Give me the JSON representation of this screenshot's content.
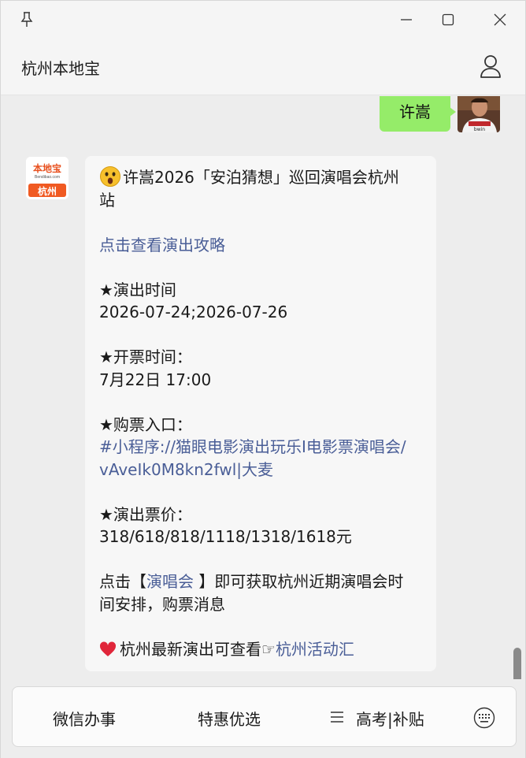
{
  "window": {
    "title": "杭州本地宝",
    "controls": [
      "pin-icon",
      "minimize-icon",
      "maximize-icon",
      "close-icon"
    ],
    "profile_icon": "user-icon"
  },
  "chat": {
    "outgoing": {
      "text": "许嵩"
    },
    "bot_avatar": {
      "top_text": "本地宝",
      "mid_text": "Bendibao.com",
      "bottom_text": "杭州"
    },
    "message": {
      "title_line_1": "许嵩2026「安泊猜想」巡回演唱会杭州",
      "title_line_2": "站",
      "guide_link": "点击查看演出攻略",
      "show_time_label": "★演出时间",
      "show_time_value": "2026-07-24;2026-07-26",
      "sale_time_label": "★开票时间：",
      "sale_time_value": "7月22日 17:00",
      "ticket_entry_label": "★购票入口：",
      "ticket_link_1": "#小程序://猫眼电影演出玩乐I电影票演唱会/",
      "ticket_link_2": "vAveIk0M8kn2fwl|大麦",
      "price_label": "★演出票价：",
      "price_value": "318/618/818/1118/1318/1618元",
      "concert_prefix": "点击【",
      "concert_link": "演唱会",
      "concert_suffix": " 】即可获取杭州近期演唱会时",
      "concert_line_2": "间安排，购票消息",
      "latest_prefix": "杭州最新演出可查看☞",
      "latest_link": "杭州活动汇"
    }
  },
  "menu": {
    "items": [
      "微信办事",
      "特惠优选",
      "高考|补贴"
    ],
    "keyboard_icon": "keyboard-icon"
  },
  "colors": {
    "bubble_out": "#95ec69",
    "link": "#4a5e97",
    "background": "#ededed"
  }
}
